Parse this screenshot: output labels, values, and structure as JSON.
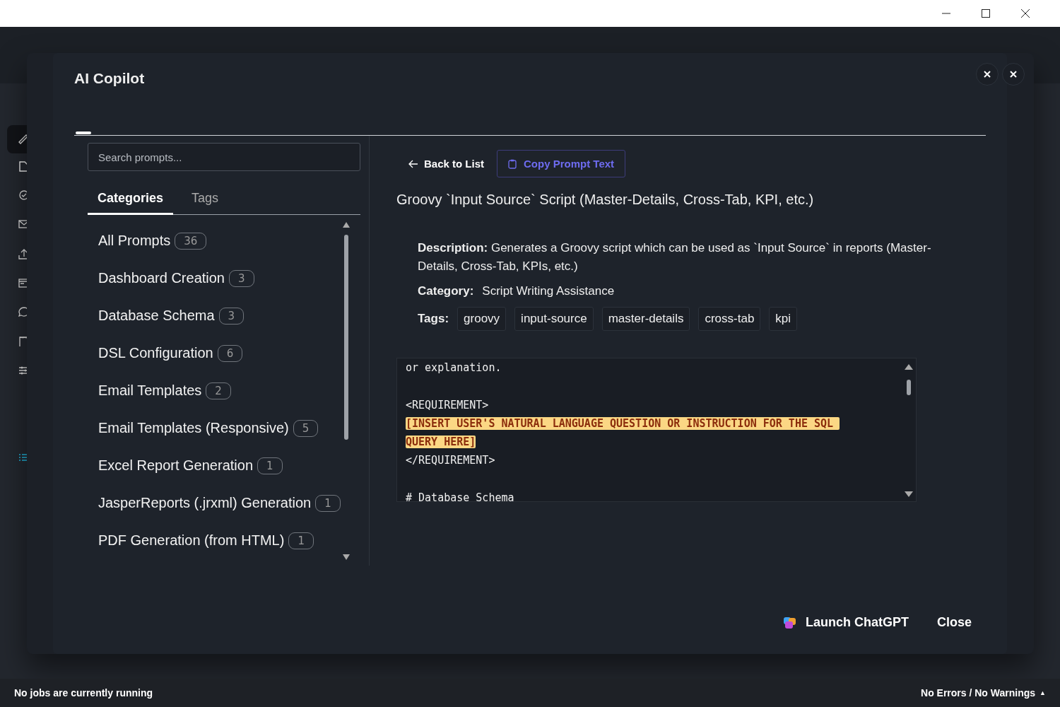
{
  "copilot_dialog": {
    "title": "AI Copilot",
    "search": {
      "placeholder": "Search prompts..."
    },
    "tabs": [
      {
        "label": "Categories",
        "selected": true
      },
      {
        "label": "Tags",
        "selected": false
      }
    ],
    "categories": [
      {
        "name": "All Prompts",
        "count": "36"
      },
      {
        "name": "Dashboard Creation",
        "count": "3"
      },
      {
        "name": "Database Schema",
        "count": "3"
      },
      {
        "name": "DSL Configuration",
        "count": "6"
      },
      {
        "name": "Email Templates",
        "count": "2"
      },
      {
        "name": "Email Templates (Responsive)",
        "count": "5"
      },
      {
        "name": "Excel Report Generation",
        "count": "1"
      },
      {
        "name": "JasperReports (.jrxml) Generation",
        "count": "1"
      },
      {
        "name": "PDF Generation (from HTML)",
        "count": "1"
      }
    ],
    "detail": {
      "back_button": "Back to List",
      "copy_button": "Copy Prompt Text",
      "title": "Groovy `Input Source` Script (Master-Details, Cross-Tab, KPI, etc.)",
      "description_label": "Description:",
      "description": "Generates a Groovy script which can be used as `Input Source` in reports (Master-Details, Cross-Tab, KPIs, etc.)",
      "category_label": "Category:",
      "category": "Script Writing Assistance",
      "tags_label": "Tags:",
      "tags": [
        "groovy",
        "input-source",
        "master-details",
        "cross-tab",
        "kpi"
      ],
      "prompt_lines": [
        {
          "kind": "text",
          "text": "or explanation.",
          "highlight": false
        },
        {
          "kind": "blank"
        },
        {
          "kind": "text",
          "text": "<REQUIREMENT>",
          "highlight": false
        },
        {
          "kind": "text",
          "text": "[INSERT USER'S NATURAL LANGUAGE QUESTION OR INSTRUCTION FOR THE SQL ",
          "highlight": true
        },
        {
          "kind": "text",
          "text": "QUERY HERE]",
          "highlight": true
        },
        {
          "kind": "text",
          "text": "</REQUIREMENT>",
          "highlight": false
        },
        {
          "kind": "blank"
        },
        {
          "kind": "text",
          "text": "# Database Schema",
          "highlight": false
        }
      ]
    },
    "footer": {
      "launch_button": "Launch ChatGPT",
      "close_button": "Close"
    }
  },
  "status_bar": {
    "left": "No jobs are currently running",
    "right": "No Errors / No Warnings",
    "right_icon": "▲"
  }
}
